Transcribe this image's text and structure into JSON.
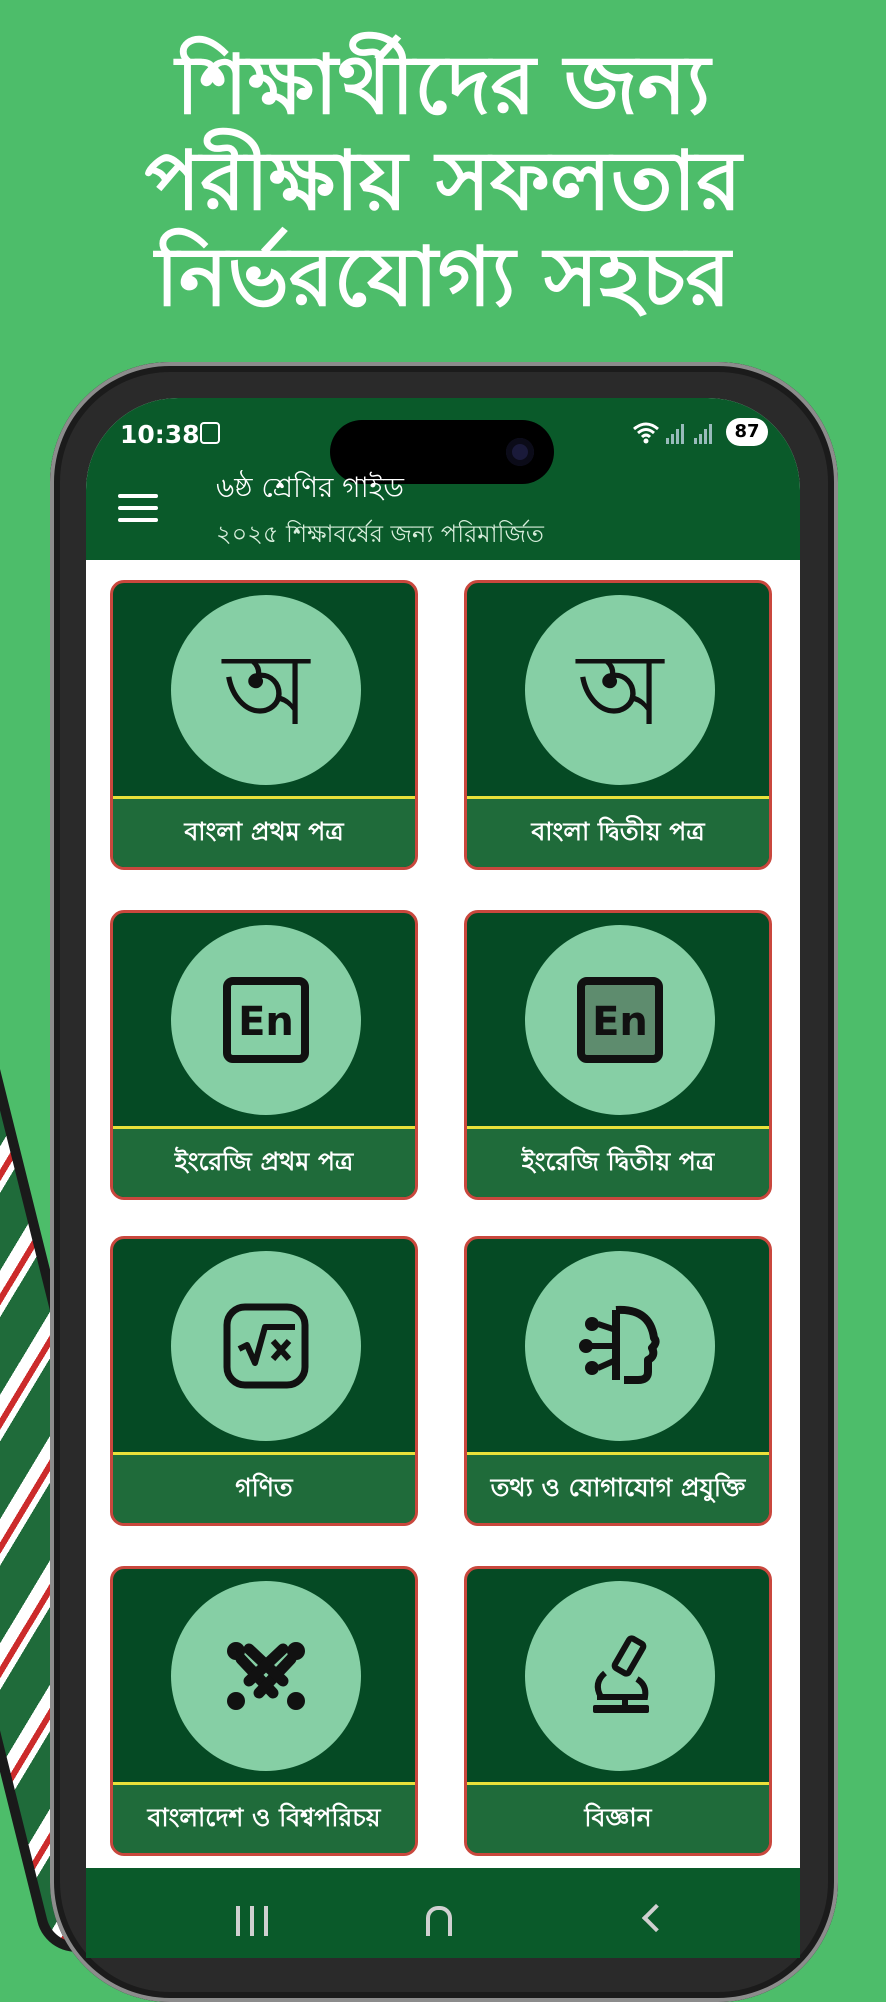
{
  "headline": [
    "শিক্ষার্থীদের জন্য",
    "পরীক্ষায় সফলতার",
    "নির্ভরযোগ্য সহচর"
  ],
  "status": {
    "time": "10:38",
    "battery": "87"
  },
  "app": {
    "title": "৬ষ্ঠ শ্রেণির গাইড",
    "subtitle": "২০২৫ শিক্ষাবর্ষের জন্য পরিমার্জিত"
  },
  "subjects": [
    {
      "label": "বাংলা প্রথম পত্র",
      "icon": "bangla-letter-icon",
      "glyph": "অ"
    },
    {
      "label": "বাংলা দ্বিতীয় পত্র",
      "icon": "bangla-letter-icon",
      "glyph": "অ"
    },
    {
      "label": "ইংরেজি প্রথম পত্র",
      "icon": "english-en-icon",
      "glyph": "En"
    },
    {
      "label": "ইংরেজি দ্বিতীয় পত্র",
      "icon": "english-en-icon",
      "glyph": "En"
    },
    {
      "label": "গণিত",
      "icon": "math-sqrt-icon"
    },
    {
      "label": "তথ্য ও যোগাযোগ প্রযুক্তি",
      "icon": "ai-brain-icon"
    },
    {
      "label": "বাংলাদেশ ও বিশ্বপরিচয়",
      "icon": "joomla-knot-icon"
    },
    {
      "label": "বিজ্ঞান",
      "icon": "microscope-icon"
    }
  ],
  "colors": {
    "background": "#4dbd6a",
    "appbar": "#0a5a2a",
    "card": "#054a24",
    "card_border": "#c9473d",
    "circle": "#86cfa5",
    "label_bar": "#1f6b3a",
    "divider": "#e9e13a"
  }
}
